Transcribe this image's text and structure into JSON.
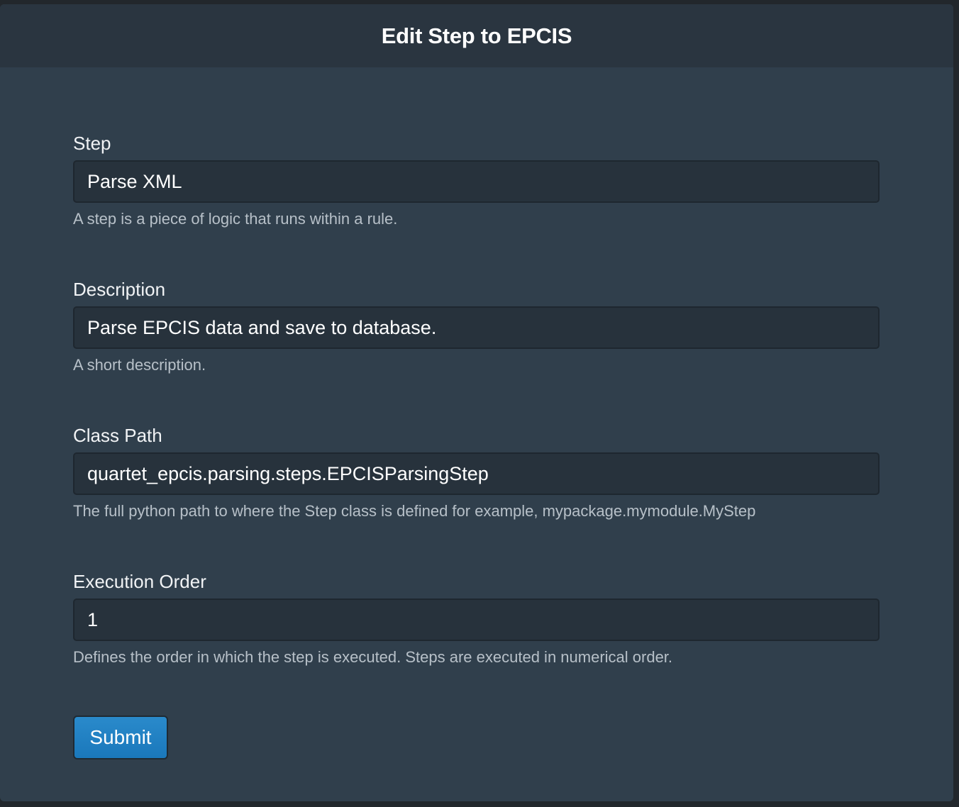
{
  "header": {
    "title": "Edit Step to EPCIS"
  },
  "fields": [
    {
      "label": "Step",
      "value": "Parse XML",
      "help": "A step is a piece of logic that runs within a rule."
    },
    {
      "label": "Description",
      "value": "Parse EPCIS data and save to database.",
      "help": "A short description."
    },
    {
      "label": "Class Path",
      "value": "quartet_epcis.parsing.steps.EPCISParsingStep",
      "help": "The full python path to where the Step class is defined for example, mypackage.mymodule.MyStep"
    },
    {
      "label": "Execution Order",
      "value": "1",
      "help": "Defines the order in which the step is executed. Steps are executed in numerical order."
    }
  ],
  "submit_label": "Submit",
  "colors": {
    "accent": "#1f82c4",
    "background": "#303f4c",
    "header": "#2a3540"
  }
}
